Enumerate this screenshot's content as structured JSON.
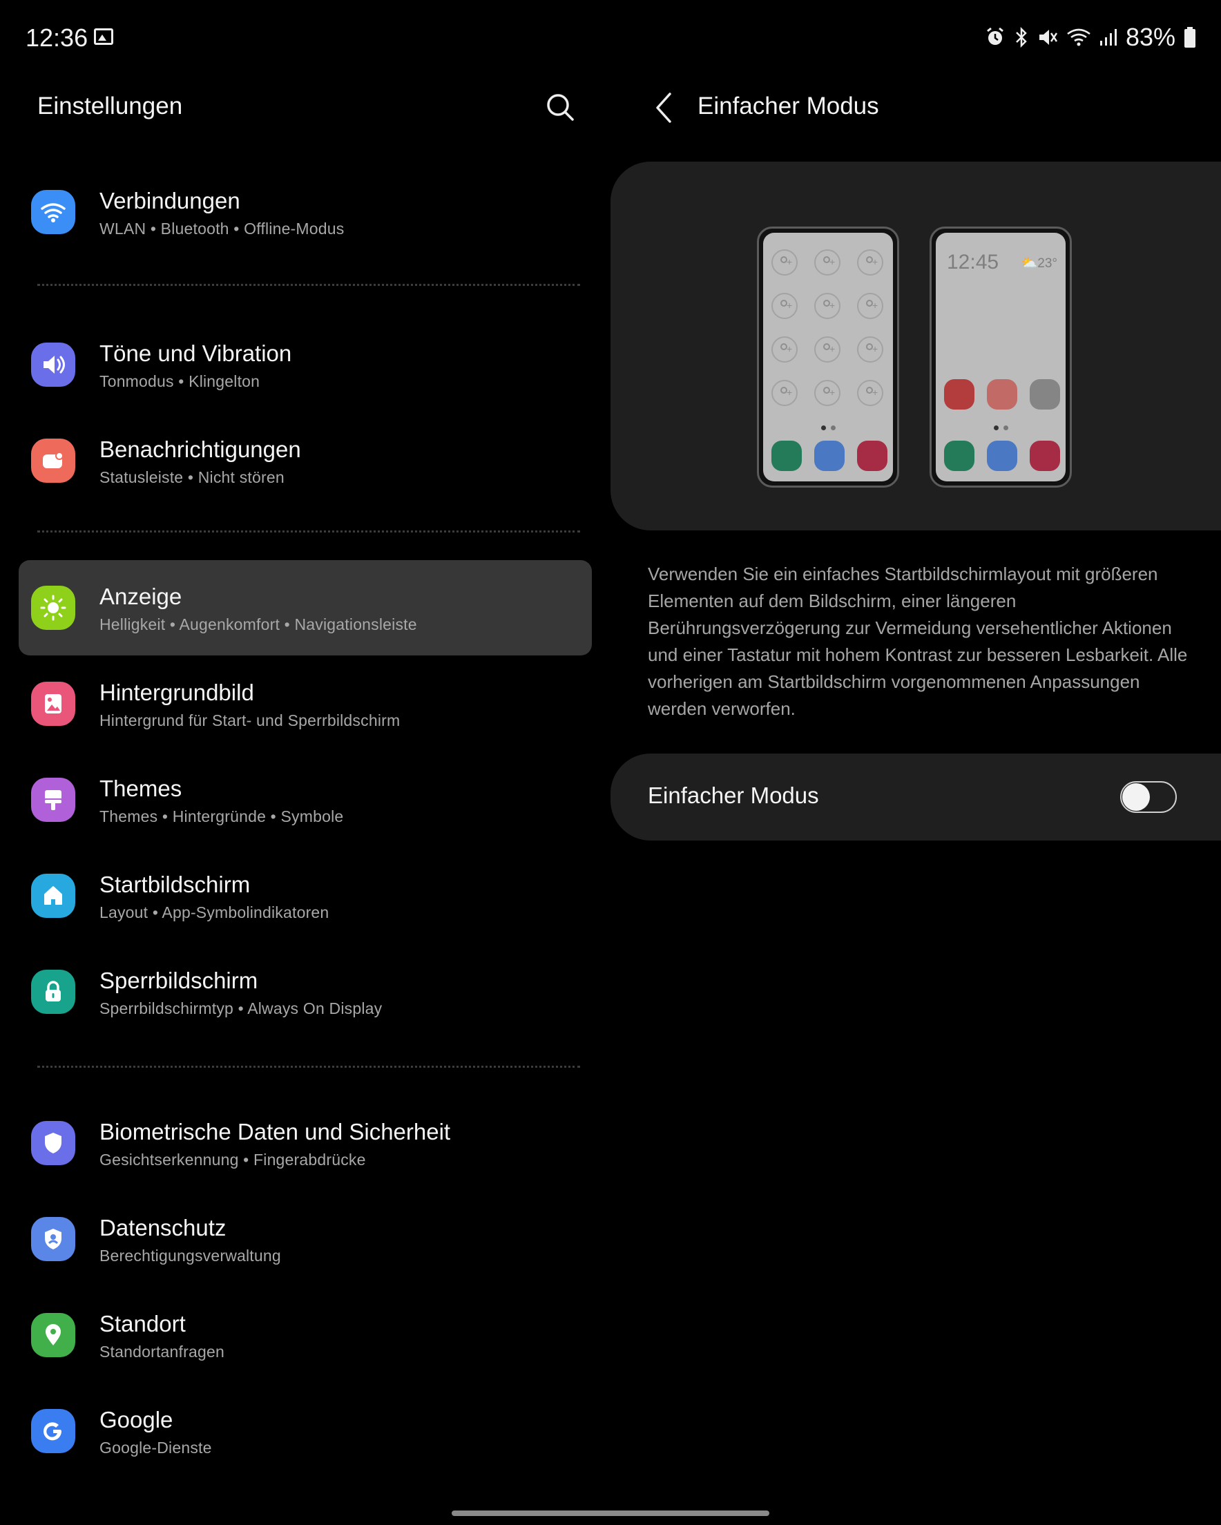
{
  "status_bar": {
    "time": "12:36",
    "battery": "83%",
    "icons": [
      "gallery-icon",
      "alarm-icon",
      "bluetooth-icon",
      "mute-icon",
      "wifi-icon",
      "signal-icon",
      "battery-icon"
    ]
  },
  "left": {
    "title": "Einstellungen",
    "search_icon": "search-icon",
    "items": [
      {
        "label": "Verbindungen",
        "sub": "WLAN  •  Bluetooth  •  Offline-Modus",
        "icon": "wifi-icon",
        "color": "#3a8ef5"
      },
      {
        "label": "Töne und Vibration",
        "sub": "Tonmodus  •  Klingelton",
        "icon": "speaker-icon",
        "color": "#6a6ee8"
      },
      {
        "label": "Benachrichtigungen",
        "sub": "Statusleiste  •  Nicht stören",
        "icon": "notification-icon",
        "color": "#ee6a5b"
      },
      {
        "label": "Anzeige",
        "sub": "Helligkeit  •  Augenkomfort  •  Navigationsleiste",
        "icon": "sun-icon",
        "color": "#8fd11a",
        "selected": true
      },
      {
        "label": "Hintergrundbild",
        "sub": "Hintergrund für Start- und Sperrbildschirm",
        "icon": "image-icon",
        "color": "#e9567a"
      },
      {
        "label": "Themes",
        "sub": "Themes  •  Hintergründe  •  Symbole",
        "icon": "brush-icon",
        "color": "#b060d8"
      },
      {
        "label": "Startbildschirm",
        "sub": "Layout  •  App-Symbolindikatoren",
        "icon": "home-icon",
        "color": "#27a8df"
      },
      {
        "label": "Sperrbildschirm",
        "sub": "Sperrbildschirmtyp  •  Always On Display",
        "icon": "lock-icon",
        "color": "#17a38c"
      },
      {
        "label": "Biometrische Daten und Sicherheit",
        "sub": "Gesichtserkennung  •  Fingerabdrücke",
        "icon": "shield-icon",
        "color": "#6a6ee8"
      },
      {
        "label": "Datenschutz",
        "sub": "Berechtigungsverwaltung",
        "icon": "privacy-shield-icon",
        "color": "#5a86e8"
      },
      {
        "label": "Standort",
        "sub": "Standortanfragen",
        "icon": "location-icon",
        "color": "#42b04a"
      },
      {
        "label": "Google",
        "sub": "Google-Dienste",
        "icon": "google-icon",
        "color": "#3a7df0"
      }
    ]
  },
  "right": {
    "back_icon": "back-icon",
    "title": "Einfacher Modus",
    "preview": {
      "phone2_time": "12:45",
      "phone2_weather": "23°",
      "dock_colors": [
        "#237b5a",
        "#4a78c2",
        "#a62c45"
      ],
      "easy_app_colors": [
        "#b33c3c",
        "#c26b66",
        "#858585"
      ]
    },
    "description": "Verwenden Sie ein einfaches Startbildschirmlayout mit größeren Elementen auf dem Bildschirm, einer längeren Berührungsverzögerung zur Vermeidung versehentlicher Aktionen und einer Tastatur mit hohem Kontrast zur besseren Lesbarkeit. Alle vorherigen am Startbildschirm vorgenommenen Anpassungen werden verworfen.",
    "toggle_label": "Einfacher Modus",
    "toggle_on": false
  }
}
